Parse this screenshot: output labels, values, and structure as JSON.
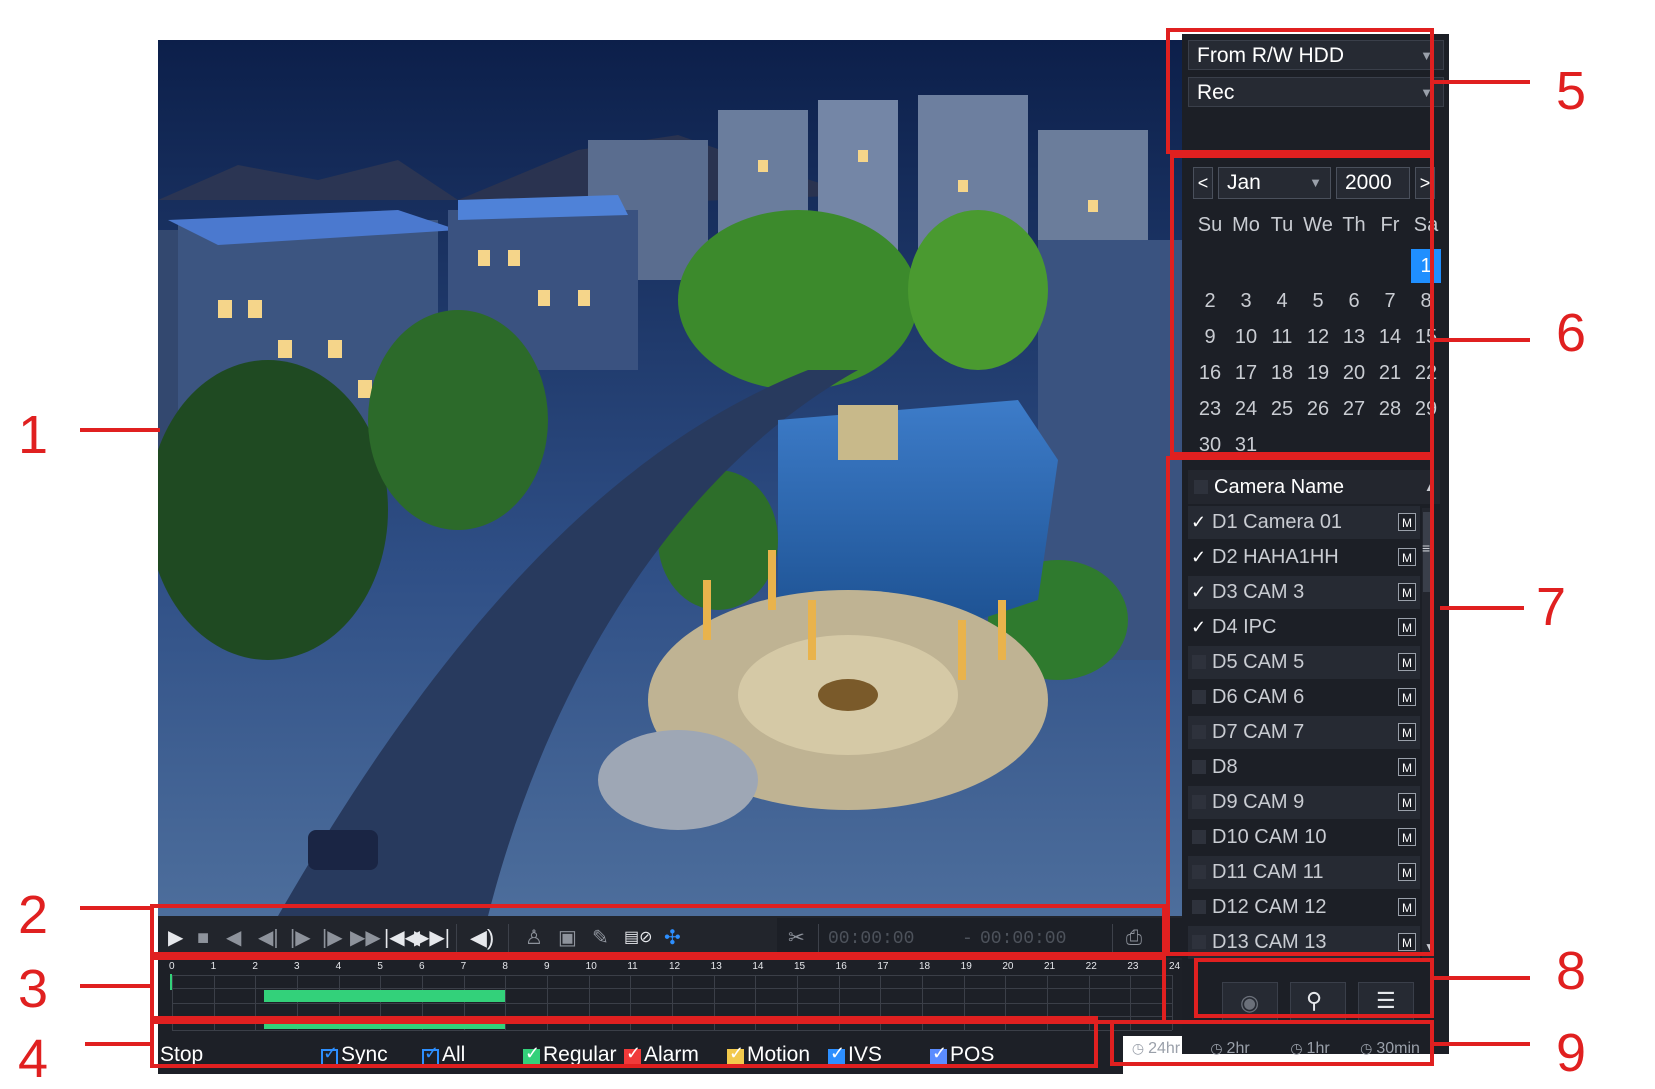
{
  "source": {
    "selected": "From R/W HDD"
  },
  "record_type": {
    "selected": "Rec"
  },
  "calendar": {
    "prev": "<",
    "next": ">",
    "month": "Jan",
    "year": "2000",
    "weekdays": [
      "Su",
      "Mo",
      "Tu",
      "We",
      "Th",
      "Fr",
      "Sa"
    ],
    "days": [
      "1",
      "2",
      "3",
      "4",
      "5",
      "6",
      "7",
      "8",
      "9",
      "10",
      "11",
      "12",
      "13",
      "14",
      "15",
      "16",
      "17",
      "18",
      "19",
      "20",
      "21",
      "22",
      "23",
      "24",
      "25",
      "26",
      "27",
      "28",
      "29",
      "30",
      "31"
    ],
    "selected_day": "1"
  },
  "cameras": {
    "header": "Camera Name",
    "items": [
      {
        "name": "D1 Camera 01",
        "checked": true
      },
      {
        "name": "D2 HAHA1HH",
        "checked": true
      },
      {
        "name": "D3 CAM 3",
        "checked": true
      },
      {
        "name": "D4 IPC",
        "checked": true
      },
      {
        "name": "D5 CAM 5",
        "checked": false
      },
      {
        "name": "D6 CAM 6",
        "checked": false
      },
      {
        "name": "D7 CAM 7",
        "checked": false
      },
      {
        "name": "D8",
        "checked": false
      },
      {
        "name": "D9 CAM 9",
        "checked": false
      },
      {
        "name": "D10 CAM 10",
        "checked": false
      },
      {
        "name": "D11 CAM 11",
        "checked": false
      },
      {
        "name": "D12 CAM 12",
        "checked": false
      },
      {
        "name": "D13 CAM 13",
        "checked": false
      }
    ],
    "main_stream_badge": "M"
  },
  "controls": {
    "start_time": "00:00:00",
    "dash": "-",
    "end_time": "00:00:00"
  },
  "timeline": {
    "hours": [
      "0",
      "1",
      "2",
      "3",
      "4",
      "5",
      "6",
      "7",
      "8",
      "9",
      "10",
      "11",
      "12",
      "13",
      "14",
      "15",
      "16",
      "17",
      "18",
      "19",
      "20",
      "21",
      "22",
      "23",
      "24"
    ],
    "segments": [
      {
        "row": 0,
        "start": 2.2,
        "end": 8.0
      },
      {
        "row": 1,
        "start": 2.2,
        "end": 8.0
      }
    ]
  },
  "legend": {
    "status": "Stop",
    "sync": "Sync",
    "all": "All",
    "regular": "Regular",
    "alarm": "Alarm",
    "motion": "Motion",
    "ivs": "IVS",
    "pos": "POS",
    "colors": {
      "regular": "#33d17a",
      "alarm": "#f03a3a",
      "motion": "#f2c94c",
      "ivs": "#2d8fff",
      "pos": "#5b8cff"
    }
  },
  "ranges": [
    "24hr",
    "2hr",
    "1hr",
    "30min"
  ],
  "callouts": [
    "1",
    "2",
    "3",
    "4",
    "5",
    "6",
    "7",
    "8",
    "9"
  ]
}
